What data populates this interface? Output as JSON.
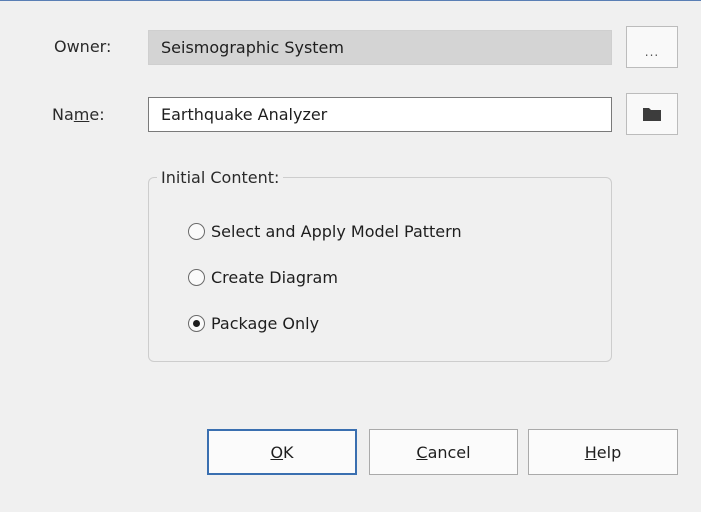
{
  "owner": {
    "label_pre": "Owner:",
    "value": "Seismographic System",
    "browse_label": "..."
  },
  "name": {
    "label_pre": "Na",
    "label_mnemonic": "m",
    "label_post": "e:",
    "value": "Earthquake Analyzer",
    "browse_icon": "folder-icon"
  },
  "initial_content": {
    "legend": "Initial Content:",
    "options": [
      {
        "label": "Select and Apply Model Pattern",
        "selected": false
      },
      {
        "label": "Create Diagram",
        "selected": false
      },
      {
        "label": "Package Only",
        "selected": true
      }
    ]
  },
  "buttons": {
    "ok": {
      "mnemonic": "O",
      "rest": "K"
    },
    "cancel": {
      "mnemonic": "C",
      "rest": "ancel"
    },
    "help": {
      "mnemonic": "H",
      "rest": "elp"
    }
  },
  "colors": {
    "window_bg": "#f0f0f0",
    "readonly_field_bg": "#d4d4d4",
    "default_button_border": "#3a6fb0"
  }
}
